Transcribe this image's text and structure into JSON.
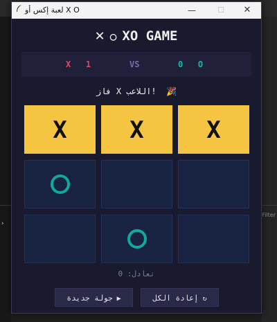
{
  "window": {
    "title": "لعبة إكس أو X O",
    "controls": {
      "minimize": "—",
      "maximize": "☐",
      "close": "✕"
    }
  },
  "header": {
    "x_symbol": "✕",
    "o_symbol": "○",
    "title": "XO GAME"
  },
  "scoreboard": {
    "x_label": "X",
    "x_score": "1",
    "vs": "VS",
    "o_label": "O",
    "o_score": "0"
  },
  "status": {
    "text": "فاز X اللاعب!",
    "icon": "🎉"
  },
  "board": {
    "cells": [
      "X",
      "X",
      "X",
      "O",
      "",
      "",
      "",
      "O",
      ""
    ],
    "winning_cells": [
      0,
      1,
      2
    ]
  },
  "draws": {
    "text": "تعادل: 0"
  },
  "buttons": {
    "new_round": {
      "label": "جولة جديدة",
      "icon": "▶"
    },
    "reset_all": {
      "label": "إعادة الكل",
      "icon": "↻"
    }
  },
  "background": {
    "filter_text": "Filter",
    "caret": "›"
  },
  "colors": {
    "x_accent": "#e94560",
    "o_accent": "#12a99a",
    "win_highlight": "#f5c542",
    "cell_bg": "#172340",
    "window_bg": "#1a1a2e"
  }
}
